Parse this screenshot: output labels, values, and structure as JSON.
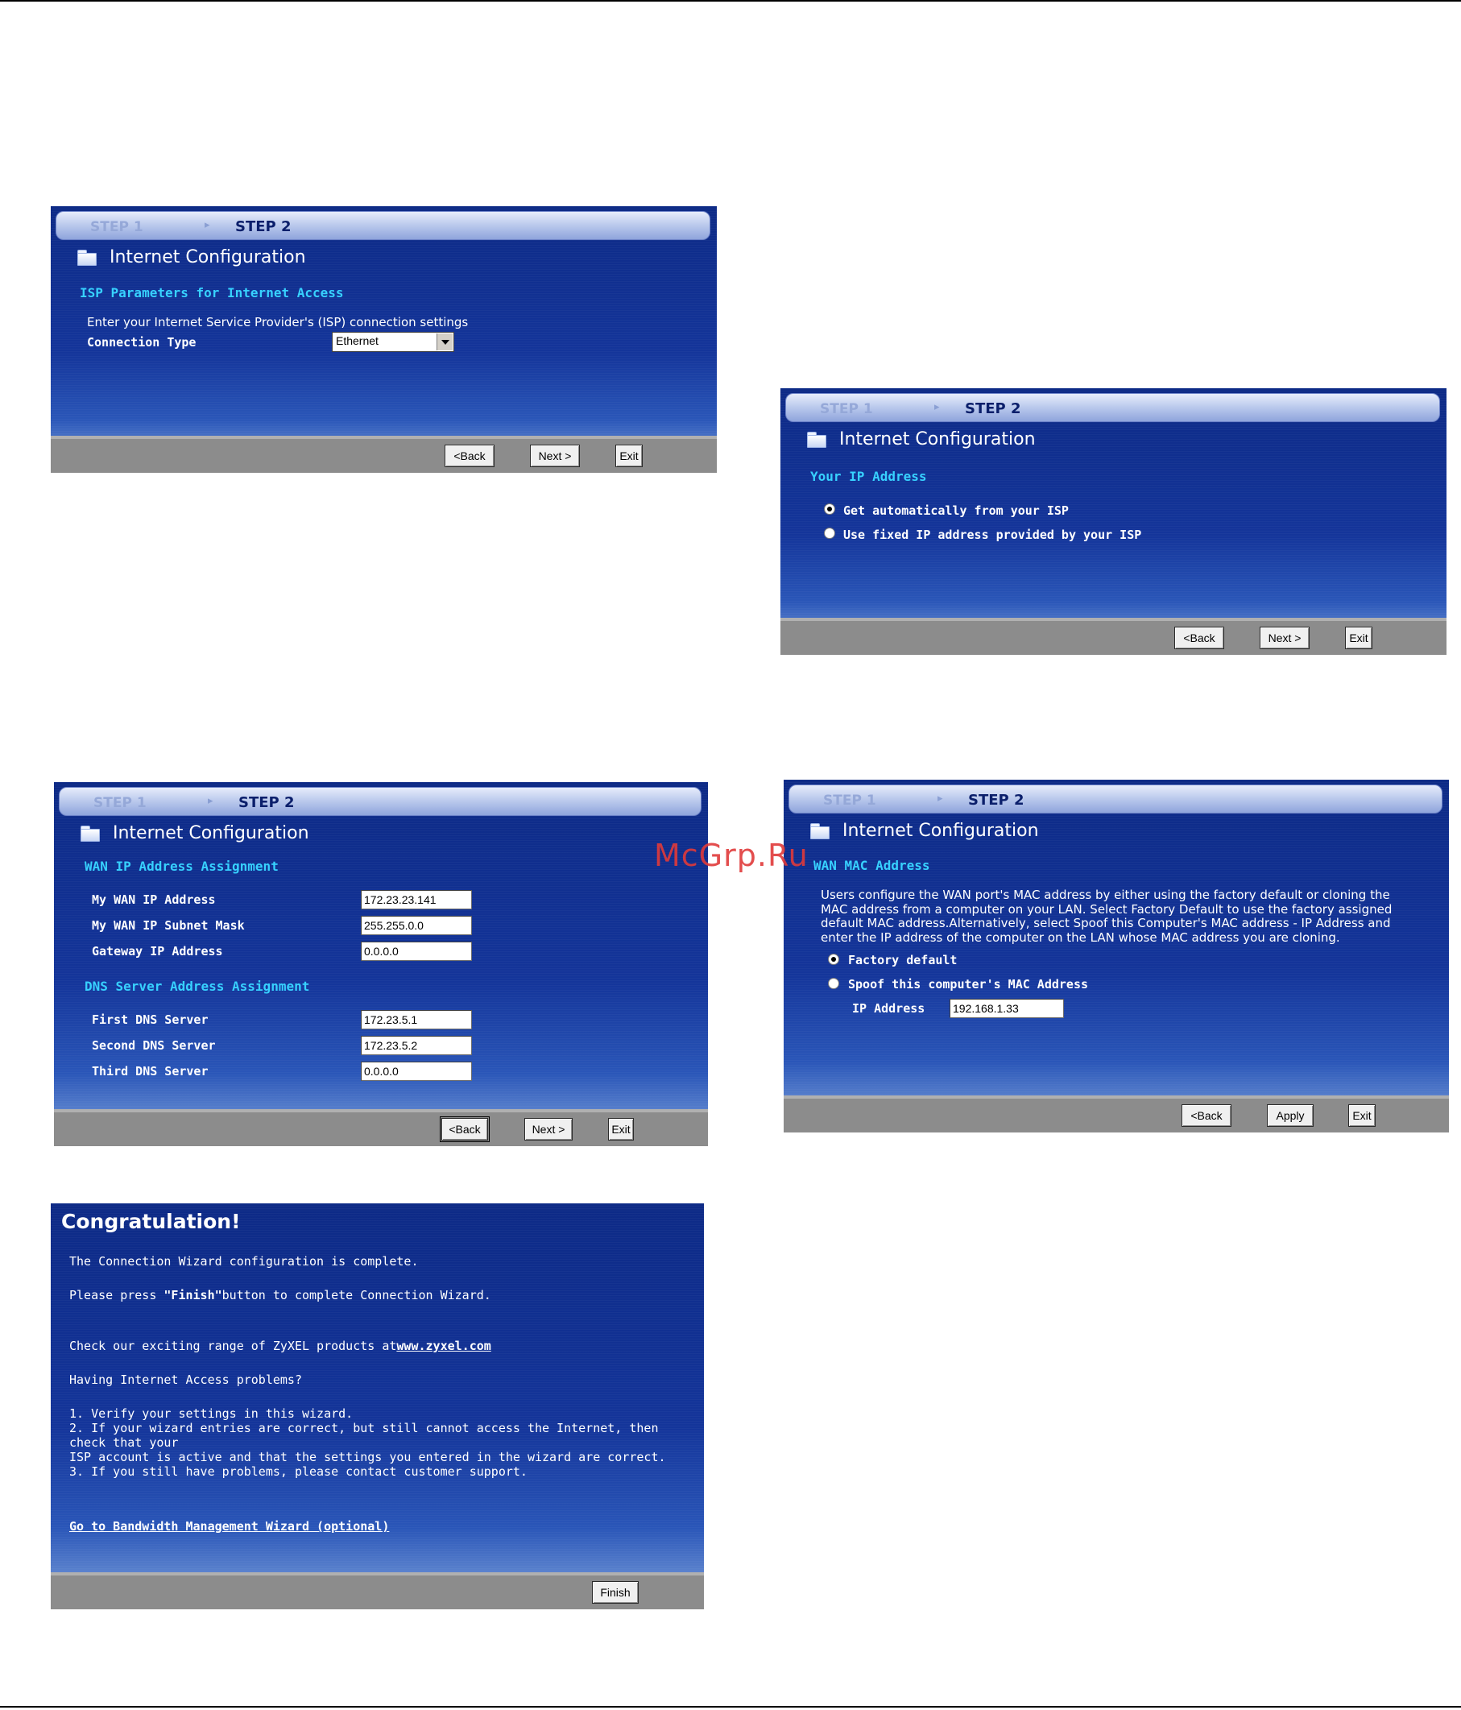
{
  "common": {
    "step1": "STEP 1",
    "step2": "STEP 2",
    "title": "Internet Configuration",
    "back": "<Back",
    "next": "Next >",
    "exit": "Exit",
    "apply": "Apply",
    "finish": "Finish"
  },
  "isp": {
    "section": "ISP Parameters for Internet Access",
    "intro": "Enter your Internet Service Provider's (ISP) connection settings",
    "connection_type_label": "Connection Type",
    "connection_type_value": "Ethernet"
  },
  "ip": {
    "section": "Your IP Address",
    "option_auto": "Get automatically from your ISP",
    "option_fixed": "Use fixed IP address provided by your ISP"
  },
  "wan": {
    "section": "WAN IP Address Assignment",
    "fields": [
      {
        "label": "My WAN IP Address",
        "value": "172.23.23.141"
      },
      {
        "label": "My WAN IP Subnet Mask",
        "value": "255.255.0.0"
      },
      {
        "label": "Gateway IP Address",
        "value": "0.0.0.0"
      }
    ],
    "dns_section": "DNS Server Address Assignment",
    "dns": [
      {
        "label": "First DNS Server",
        "value": "172.23.5.1"
      },
      {
        "label": "Second DNS Server",
        "value": "172.23.5.2"
      },
      {
        "label": "Third DNS Server",
        "value": "0.0.0.0"
      }
    ]
  },
  "mac": {
    "section": "WAN MAC Address",
    "desc_lines": [
      "Users configure the WAN port's MAC address by either using the factory default or cloning the",
      "MAC address from a computer on your LAN. Select Factory Default to use the factory assigned",
      "default MAC address.Alternatively, select Spoof this Computer's MAC address - IP Address and",
      "enter the IP address of the computer on the LAN whose MAC address you are cloning."
    ],
    "option_factory": "Factory default",
    "option_spoof": "Spoof this computer's MAC Address",
    "ip_label": "IP Address",
    "ip_value": "192.168.1.33"
  },
  "congrats": {
    "title": "Congratulation!",
    "line1": "The Connection Wizard configuration is complete.",
    "line2_pre": "Please press ",
    "line2_bold": "\"Finish\"",
    "line2_post": "button to complete Connection Wizard.",
    "line3_pre": "Check our exciting range of ZyXEL products at",
    "line3_link": "www.zyxel.com",
    "line4": "Having Internet Access problems?",
    "list": [
      "1. Verify your settings in this wizard.",
      "2. If your wizard entries are correct, but still cannot access the Internet, then check that your",
      "ISP account is active and that the settings you entered in the wizard are correct.",
      "3. If you still have problems, please contact customer support."
    ],
    "bandwidth_link": "Go to Bandwidth Management Wizard (optional)"
  },
  "watermark": "McGrp.Ru"
}
